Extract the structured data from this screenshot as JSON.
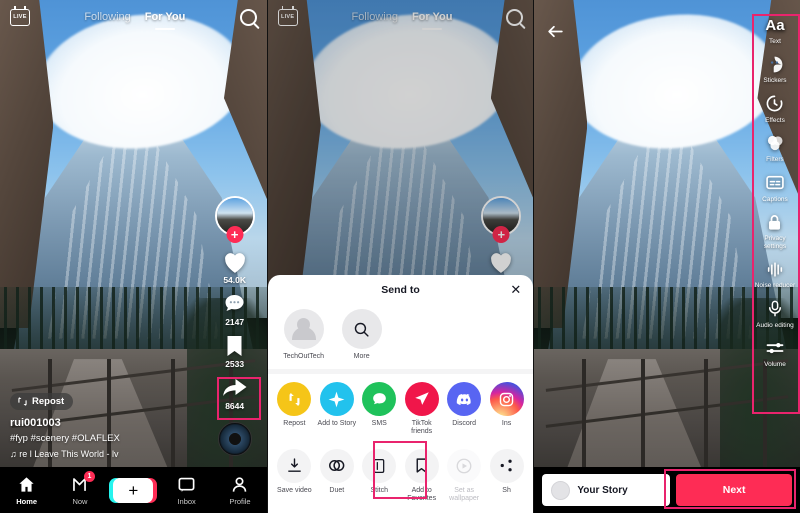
{
  "feed": {
    "live_label": "LIVE",
    "tabs": [
      {
        "label": "Following",
        "active": false
      },
      {
        "label": "For You",
        "active": true
      }
    ],
    "search_icon": "search-icon",
    "actions": {
      "like_count": "54.0K",
      "comment_count": "2147",
      "bookmark_count": "2533",
      "share_count": "8644"
    },
    "repost_label": "Repost",
    "username": "rui001003",
    "hashtags": "#fyp #scenery #OLAFLEX",
    "music": "re l Leave This World - lv",
    "tabbar": [
      {
        "label": "Home",
        "icon": "home-icon",
        "badge": ""
      },
      {
        "label": "Now",
        "icon": "now-icon",
        "badge": "1"
      },
      {
        "label": "",
        "icon": "create-plus-icon",
        "badge": ""
      },
      {
        "label": "Inbox",
        "icon": "inbox-icon",
        "badge": ""
      },
      {
        "label": "Profile",
        "icon": "profile-icon",
        "badge": ""
      }
    ]
  },
  "share_sheet": {
    "title": "Send to",
    "close_icon": "close-icon",
    "people": [
      {
        "label": "TechOutTech",
        "icon": "avatar-placeholder-icon"
      },
      {
        "label": "More",
        "icon": "search-icon"
      }
    ],
    "apps": [
      {
        "label": "Repost",
        "icon": "repost-icon",
        "color": "#f5c518"
      },
      {
        "label": "Add to Story",
        "icon": "sparkle-icon",
        "color": "#22c2ed"
      },
      {
        "label": "SMS",
        "icon": "message-bubble-icon",
        "color": "#1fc25b"
      },
      {
        "label": "TikTok friends",
        "icon": "send-plane-icon",
        "color": "#f0164a"
      },
      {
        "label": "Discord",
        "icon": "discord-icon",
        "color": "#5865f2"
      },
      {
        "label": "Ins",
        "icon": "instagram-icon",
        "color": "#e1306c"
      }
    ],
    "actions": [
      {
        "label": "Save video",
        "icon": "download-icon",
        "state": "enabled"
      },
      {
        "label": "Duet",
        "icon": "duet-icon",
        "state": "enabled"
      },
      {
        "label": "Stitch",
        "icon": "stitch-icon",
        "state": "highlighted"
      },
      {
        "label": "Add to Favorites",
        "icon": "bookmark-icon",
        "state": "enabled"
      },
      {
        "label": "Set as wallpaper",
        "icon": "play-circle-icon",
        "state": "disabled"
      },
      {
        "label": "Sh",
        "icon": "share-more-icon",
        "state": "enabled"
      }
    ]
  },
  "editor": {
    "back_icon": "back-arrow-icon",
    "tools": [
      {
        "label": "Text",
        "icon": "text-aa-icon"
      },
      {
        "label": "Stickers",
        "icon": "sticker-smiley-icon"
      },
      {
        "label": "Effects",
        "icon": "effects-clock-icon"
      },
      {
        "label": "Filters",
        "icon": "filters-circles-icon"
      },
      {
        "label": "Captions",
        "icon": "captions-icon"
      },
      {
        "label": "Privacy settings",
        "icon": "lock-icon"
      },
      {
        "label": "Noise reducer",
        "icon": "waveform-icon"
      },
      {
        "label": "Audio editing",
        "icon": "microphone-icon"
      },
      {
        "label": "Volume",
        "icon": "sliders-icon"
      }
    ],
    "story_button": "Your Story",
    "next_button": "Next",
    "accent_color": "#fe2c55"
  },
  "annotation": {
    "highlight_color": "#e9246d",
    "targets": [
      "share-action",
      "stitch-option",
      "editor-tool-rail",
      "next-button"
    ]
  }
}
